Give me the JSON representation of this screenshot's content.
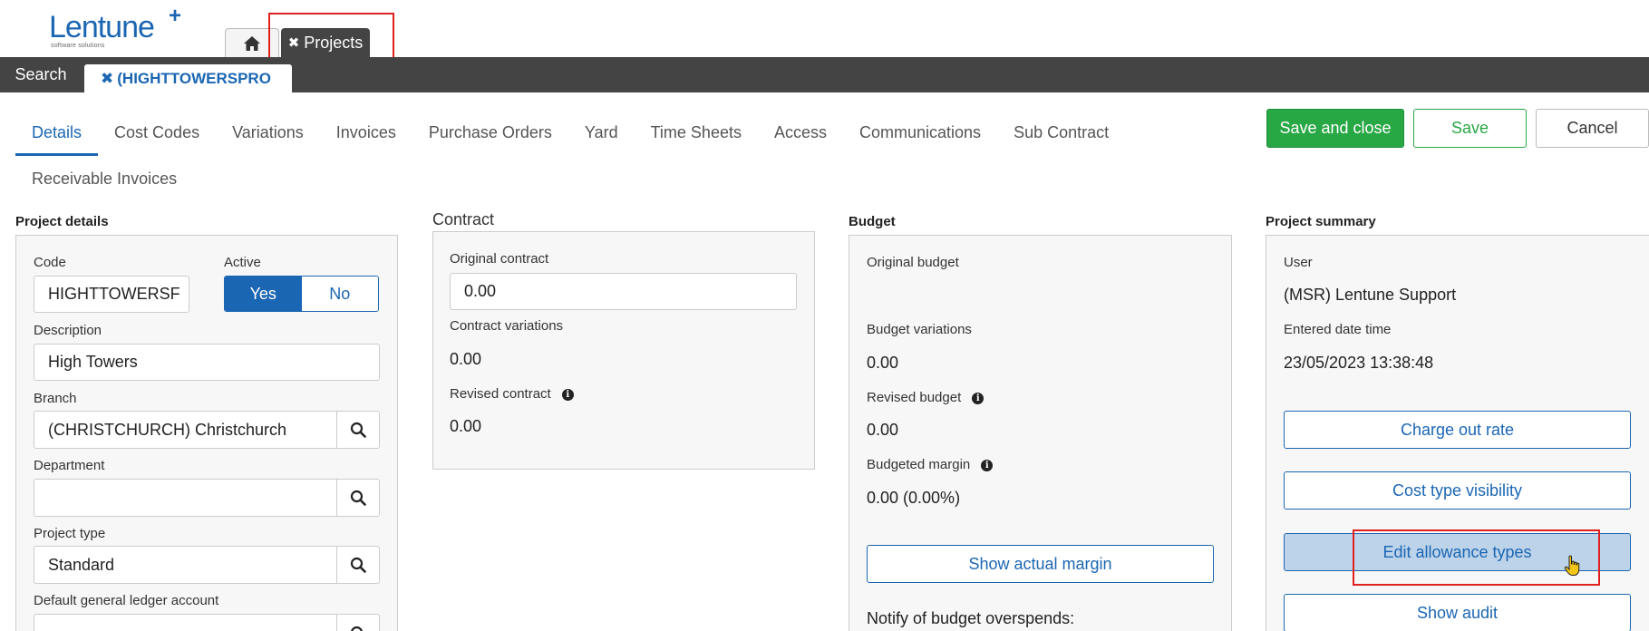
{
  "brand": {
    "name": "Lentune",
    "plus": "+",
    "tagline": "software solutions"
  },
  "tabs": {
    "home_icon": "home-icon",
    "projects_close": "✖",
    "projects_label": "Projects",
    "search_label": "Search",
    "active_close": "✖",
    "active_label": "(HIGHTTOWERSPRO"
  },
  "subnav": {
    "items": [
      "Details",
      "Cost Codes",
      "Variations",
      "Invoices",
      "Purchase Orders",
      "Yard",
      "Time Sheets",
      "Access",
      "Communications",
      "Sub Contract"
    ],
    "row2": "Receivable Invoices",
    "active": "Details"
  },
  "actions": {
    "save_close": "Save and close",
    "save": "Save",
    "cancel": "Cancel"
  },
  "project_details": {
    "title": "Project details",
    "code_label": "Code",
    "code_value": "HIGHTTOWERSF",
    "active_label": "Active",
    "yes": "Yes",
    "no": "No",
    "description_label": "Description",
    "description_value": "High Towers",
    "branch_label": "Branch",
    "branch_value": "(CHRISTCHURCH) Christchurch",
    "department_label": "Department",
    "department_value": "",
    "project_type_label": "Project type",
    "project_type_value": "Standard",
    "gl_label": "Default general ledger account",
    "gl_value": ""
  },
  "contract": {
    "title": "Contract",
    "original_label": "Original contract",
    "original_value": "0.00",
    "variations_label": "Contract variations",
    "variations_value": "0.00",
    "revised_label": "Revised contract",
    "revised_value": "0.00"
  },
  "budget": {
    "title": "Budget",
    "original_label": "Original budget",
    "variations_label": "Budget variations",
    "variations_value": "0.00",
    "revised_label": "Revised budget",
    "revised_value": "0.00",
    "margin_label": "Budgeted margin",
    "margin_value": "0.00 (0.00%)",
    "show_margin": "Show actual margin",
    "notify_label": "Notify of budget overspends:"
  },
  "summary": {
    "title": "Project summary",
    "user_label": "User",
    "user_value": "(MSR) Lentune Support",
    "entered_label": "Entered date time",
    "entered_value": "23/05/2023 13:38:48",
    "charge_out": "Charge out rate",
    "cost_type": "Cost type visibility",
    "edit_allowance": "Edit allowance types",
    "show_audit": "Show audit"
  },
  "colors": {
    "primary": "#1b66b3",
    "success": "#28a745",
    "dark_bar": "#444444",
    "highlight": "#e0201f",
    "hover": "#bcd3ea"
  }
}
